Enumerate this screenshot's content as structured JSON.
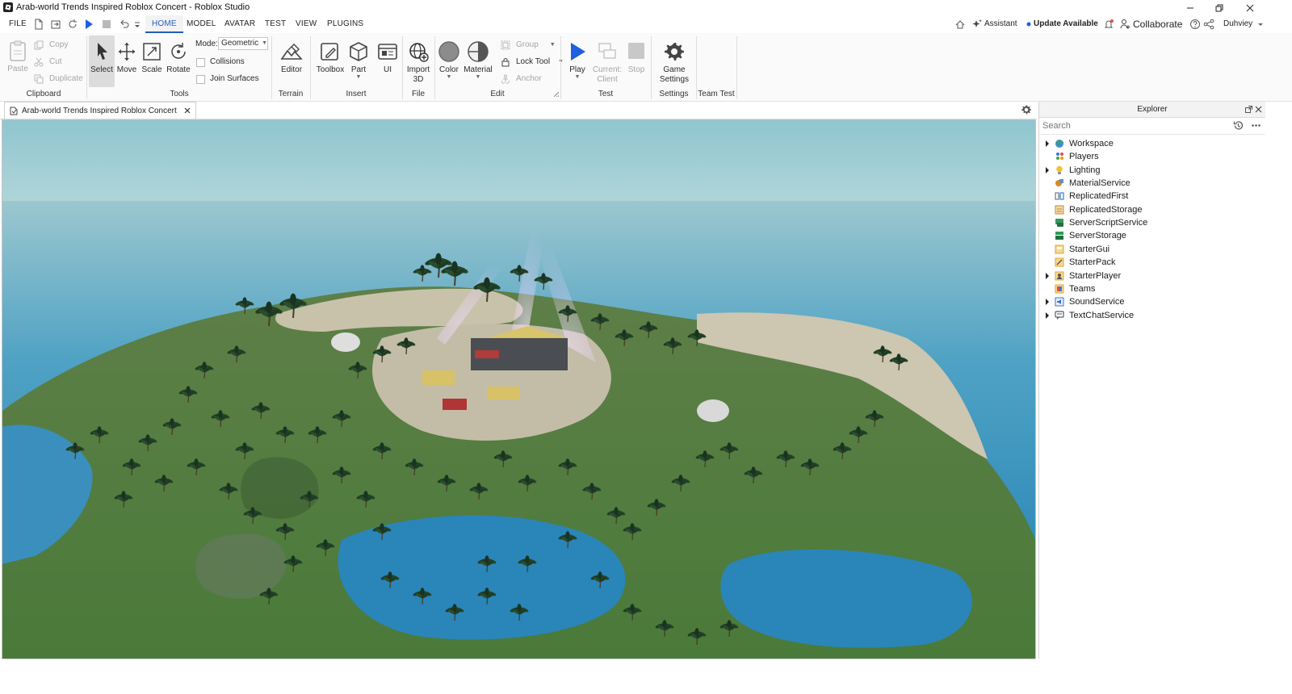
{
  "window": {
    "title": "Arab-world Trends Inspired Roblox Concert - Roblox Studio"
  },
  "menu": {
    "items": [
      "FILE",
      "HOME",
      "MODEL",
      "AVATAR",
      "TEST",
      "VIEW",
      "PLUGINS"
    ],
    "active": "HOME"
  },
  "topright": {
    "assistant": "Assistant",
    "update": "Update Available",
    "collaborate": "Collaborate",
    "user": "Duhviey"
  },
  "ribbon": {
    "clipboard": {
      "paste": "Paste",
      "copy": "Copy",
      "cut": "Cut",
      "duplicate": "Duplicate",
      "group": "Clipboard"
    },
    "tools": {
      "select": "Select",
      "move": "Move",
      "scale": "Scale",
      "rotate": "Rotate",
      "mode_label": "Mode:",
      "mode_value": "Geometric",
      "collisions": "Collisions",
      "join_surfaces": "Join Surfaces",
      "group": "Tools"
    },
    "terrain": {
      "editor": "Editor",
      "group": "Terrain"
    },
    "insert": {
      "toolbox": "Toolbox",
      "part": "Part",
      "ui": "UI",
      "group": "Insert"
    },
    "file": {
      "import_line1": "Import",
      "import_line2": "3D",
      "group": "File"
    },
    "edit": {
      "color": "Color",
      "material": "Material",
      "group_btn": "Group",
      "lock_tool": "Lock Tool",
      "anchor": "Anchor",
      "group": "Edit"
    },
    "test": {
      "play": "Play",
      "current_line1": "Current:",
      "current_line2": "Client",
      "stop": "Stop",
      "group": "Test"
    },
    "settings": {
      "game_line1": "Game",
      "game_line2": "Settings",
      "group": "Settings"
    },
    "teamtest": {
      "group": "Team Test"
    }
  },
  "document_tab": {
    "label": "Arab-world Trends Inspired Roblox Concert"
  },
  "explorer": {
    "title": "Explorer",
    "search_placeholder": "Search",
    "items": [
      {
        "label": "Workspace",
        "expandable": true,
        "icon": "workspace-icon",
        "color": "#3b8fd6"
      },
      {
        "label": "Players",
        "expandable": false,
        "icon": "players-icon",
        "color": "#e0a11a"
      },
      {
        "label": "Lighting",
        "expandable": true,
        "icon": "lighting-icon",
        "color": "#f2c230"
      },
      {
        "label": "MaterialService",
        "expandable": false,
        "icon": "material-service-icon",
        "color": "#d9892a"
      },
      {
        "label": "ReplicatedFirst",
        "expandable": false,
        "icon": "replicated-first-icon",
        "color": "#6b7a8c"
      },
      {
        "label": "ReplicatedStorage",
        "expandable": false,
        "icon": "replicated-storage-icon",
        "color": "#c98a3a"
      },
      {
        "label": "ServerScriptService",
        "expandable": false,
        "icon": "server-script-service-icon",
        "color": "#2f9c59"
      },
      {
        "label": "ServerStorage",
        "expandable": false,
        "icon": "server-storage-icon",
        "color": "#2f9c59"
      },
      {
        "label": "StarterGui",
        "expandable": false,
        "icon": "starter-gui-icon",
        "color": "#e3a33a"
      },
      {
        "label": "StarterPack",
        "expandable": false,
        "icon": "starter-pack-icon",
        "color": "#e3a33a"
      },
      {
        "label": "StarterPlayer",
        "expandable": true,
        "icon": "starter-player-icon",
        "color": "#e3a33a"
      },
      {
        "label": "Teams",
        "expandable": false,
        "icon": "teams-icon",
        "color": "#e3a33a"
      },
      {
        "label": "SoundService",
        "expandable": true,
        "icon": "sound-service-icon",
        "color": "#3b6fd6"
      },
      {
        "label": "TextChatService",
        "expandable": true,
        "icon": "text-chat-service-icon",
        "color": "#555c66"
      }
    ]
  },
  "colors": {
    "accent": "#1f5fbf",
    "play": "#1f5fe0",
    "ocean": "#2f86b5",
    "grass": "#4e7a3d",
    "sand": "#cfc7b0"
  }
}
